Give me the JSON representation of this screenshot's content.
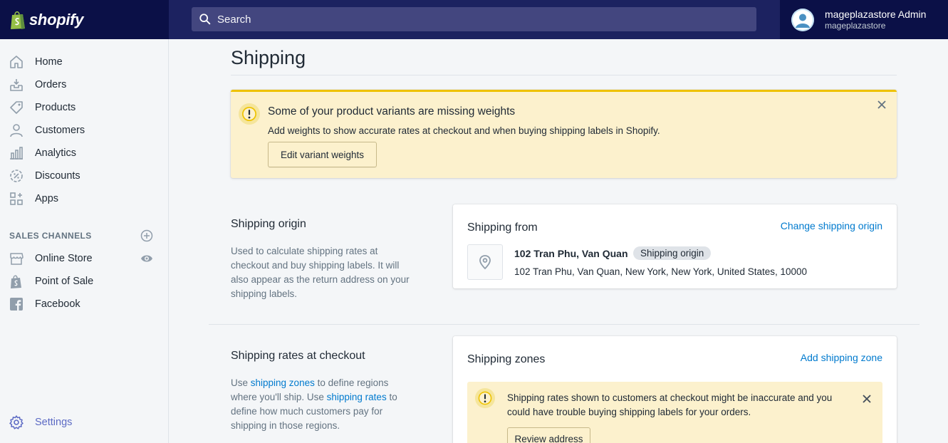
{
  "brand": {
    "name": "shopify"
  },
  "search": {
    "placeholder": "Search"
  },
  "user": {
    "name": "mageplazastore Admin",
    "store": "mageplazastore"
  },
  "sidebar": {
    "items": [
      {
        "label": "Home",
        "icon": "home-icon"
      },
      {
        "label": "Orders",
        "icon": "orders-icon"
      },
      {
        "label": "Products",
        "icon": "tag-icon"
      },
      {
        "label": "Customers",
        "icon": "person-icon"
      },
      {
        "label": "Analytics",
        "icon": "bar-chart-icon"
      },
      {
        "label": "Discounts",
        "icon": "discount-icon"
      },
      {
        "label": "Apps",
        "icon": "apps-icon"
      }
    ],
    "channels_header": "SALES CHANNELS",
    "channels": [
      {
        "label": "Online Store",
        "icon": "store-icon"
      },
      {
        "label": "Point of Sale",
        "icon": "pos-icon"
      },
      {
        "label": "Facebook",
        "icon": "facebook-icon"
      }
    ],
    "settings": "Settings"
  },
  "page": {
    "title": "Shipping"
  },
  "weight_banner": {
    "title": "Some of your product variants are missing weights",
    "text": "Add weights to show accurate rates at checkout and when buying shipping labels in Shopify.",
    "button": "Edit variant weights"
  },
  "origin_section": {
    "heading": "Shipping origin",
    "description": "Used to calculate shipping rates at checkout and buy shipping labels. It will also appear as the return address on your shipping labels."
  },
  "origin_card": {
    "title": "Shipping from",
    "action": "Change shipping origin",
    "location_name": "102 Tran Phu, Van Quan",
    "badge": "Shipping origin",
    "address": "102 Tran Phu, Van Quan, New York, New York, United States, 10000"
  },
  "rates_section": {
    "heading": "Shipping rates at checkout",
    "desc_1": "Use ",
    "link_zones": "shipping zones",
    "desc_2": " to define regions where you'll ship. Use ",
    "link_rates": "shipping rates",
    "desc_3": " to define how much customers pay for shipping in those regions."
  },
  "zones_card": {
    "title": "Shipping zones",
    "action": "Add shipping zone",
    "warning": "Shipping rates shown to customers at checkout might be inaccurate and you could have trouble buying shipping labels for your orders.",
    "button": "Review address"
  },
  "colors": {
    "topbar": "#1c2260",
    "brand_bg": "#0b1047",
    "link": "#007ace",
    "warning_bg": "#fcf1cd",
    "warning_accent": "#eec200",
    "settings_accent": "#5c6ac4"
  }
}
